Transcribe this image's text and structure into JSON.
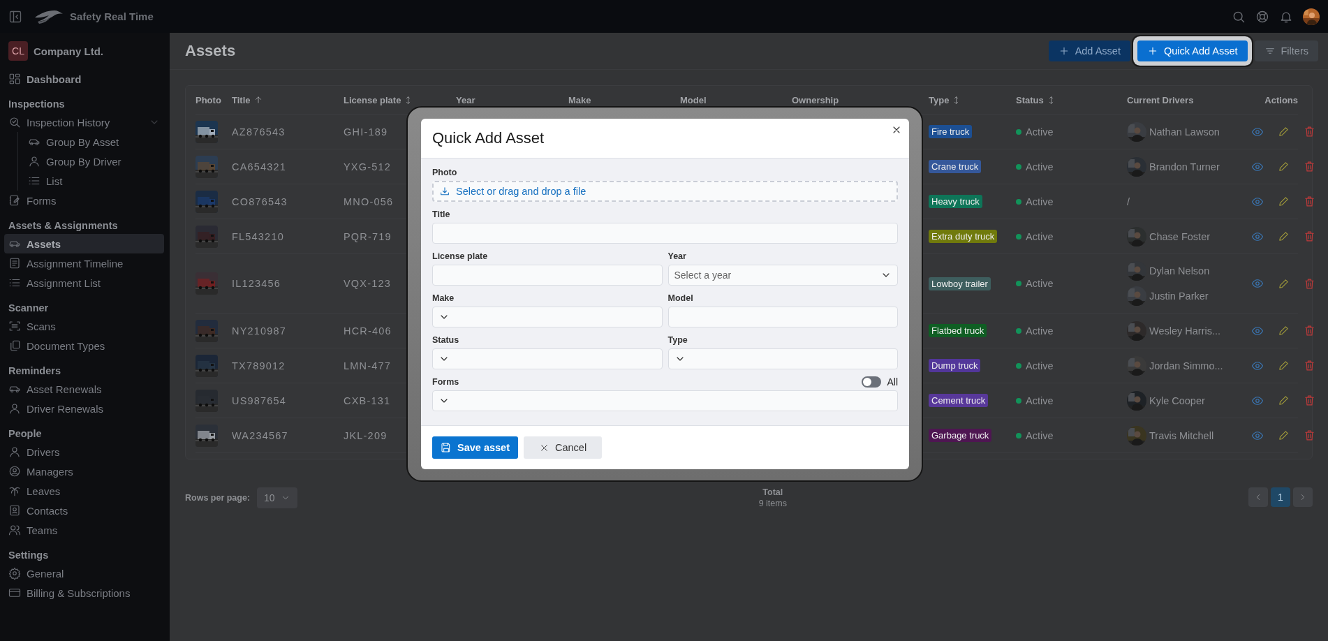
{
  "app": {
    "title": "Safety Real Time"
  },
  "sidebar": {
    "company": {
      "initials": "CL",
      "name": "Company Ltd."
    },
    "sections": [
      {
        "items": [
          {
            "label": "Dashboard",
            "kind": "dashboard",
            "selected": false
          }
        ]
      },
      {
        "heading": "Inspections",
        "items": [
          {
            "label": "Inspection History",
            "kind": "history",
            "selected": false,
            "expanded": true,
            "children": [
              {
                "label": "Group By Asset",
                "kind": "car",
                "selected": false
              },
              {
                "label": "Group By Driver",
                "kind": "person",
                "selected": false
              },
              {
                "label": "List",
                "kind": "list",
                "selected": false
              }
            ]
          },
          {
            "label": "Forms",
            "kind": "form",
            "selected": false
          }
        ]
      },
      {
        "heading": "Assets & Assignments",
        "items": [
          {
            "label": "Assets",
            "kind": "car",
            "selected": true
          },
          {
            "label": "Assignment Timeline",
            "kind": "document",
            "selected": false
          },
          {
            "label": "Assignment List",
            "kind": "list",
            "selected": false
          }
        ]
      },
      {
        "heading": "Scanner",
        "items": [
          {
            "label": "Scans",
            "kind": "scan",
            "selected": false
          },
          {
            "label": "Document Types",
            "kind": "copies",
            "selected": false
          }
        ]
      },
      {
        "heading": "Reminders",
        "items": [
          {
            "label": "Asset Renewals",
            "kind": "car",
            "selected": false
          },
          {
            "label": "Driver Renewals",
            "kind": "person",
            "selected": false
          }
        ]
      },
      {
        "heading": "People",
        "items": [
          {
            "label": "Drivers",
            "kind": "person",
            "selected": false
          },
          {
            "label": "Managers",
            "kind": "user-circle",
            "selected": false
          },
          {
            "label": "Leaves",
            "kind": "palm",
            "selected": false
          },
          {
            "label": "Contacts",
            "kind": "contact",
            "selected": false
          },
          {
            "label": "Teams",
            "kind": "people",
            "selected": false
          }
        ]
      },
      {
        "heading": "Settings",
        "items": [
          {
            "label": "General",
            "kind": "gear",
            "selected": false
          },
          {
            "label": "Billing & Subscriptions",
            "kind": "card",
            "selected": false
          }
        ]
      }
    ]
  },
  "page": {
    "title": "Assets",
    "actions": [
      {
        "label": "Add Asset",
        "kind": "add",
        "highlighted": false
      },
      {
        "label": "Quick Add Asset",
        "kind": "add",
        "highlighted": true
      },
      {
        "label": "Filters",
        "kind": "filter",
        "highlighted": false
      }
    ]
  },
  "table": {
    "columns": [
      {
        "label": "Photo",
        "sortable": false,
        "sorted_ascending": false
      },
      {
        "label": "Title",
        "sortable": true,
        "sorted_ascending": true
      },
      {
        "label": "License plate",
        "sortable": true,
        "sorted_ascending": false
      },
      {
        "label": "Year",
        "sortable": false,
        "sorted_ascending": false
      },
      {
        "label": "Make",
        "sortable": false,
        "sorted_ascending": false
      },
      {
        "label": "Model",
        "sortable": false,
        "sorted_ascending": false
      },
      {
        "label": "Ownership",
        "sortable": false,
        "sorted_ascending": false
      },
      {
        "label": "Type",
        "sortable": true,
        "sorted_ascending": false
      },
      {
        "label": "Status",
        "sortable": true,
        "sorted_ascending": false
      },
      {
        "label": "Current Drivers",
        "sortable": false,
        "sorted_ascending": false
      },
      {
        "label": "Actions",
        "sortable": false,
        "sorted_ascending": false
      }
    ],
    "rows": [
      {
        "title": "AZ876543",
        "license_plate": "GHI-189",
        "type": {
          "label": "Fire truck",
          "color": "#1c4f93"
        },
        "status": "Active",
        "current_drivers": [
          "Nathan Lawson"
        ]
      },
      {
        "title": "CA654321",
        "license_plate": "YXG-512",
        "type": {
          "label": "Crane truck",
          "color": "#35589a"
        },
        "status": "Active",
        "current_drivers": [
          "Brandon Turner"
        ]
      },
      {
        "title": "CO876543",
        "license_plate": "MNO-056",
        "type": {
          "label": "Heavy truck",
          "color": "#0e7558"
        },
        "status": "Active",
        "current_drivers": "/"
      },
      {
        "title": "FL543210",
        "license_plate": "PQR-719",
        "type": {
          "label": "Extra duty truck",
          "color": "#707a0c"
        },
        "status": "Active",
        "current_drivers": [
          "Chase Foster"
        ]
      },
      {
        "title": "IL123456",
        "license_plate": "VQX-123",
        "type": {
          "label": "Lowboy trailer",
          "color": "#3e5e5e"
        },
        "status": "Active",
        "current_drivers": [
          "Dylan Nelson",
          "Justin Parker"
        ]
      },
      {
        "title": "NY210987",
        "license_plate": "HCR-406",
        "type": {
          "label": "Flatbed truck",
          "color": "#0f5e23"
        },
        "status": "Active",
        "current_drivers": [
          "Wesley Harris..."
        ]
      },
      {
        "title": "TX789012",
        "license_plate": "LMN-477",
        "type": {
          "label": "Dump truck",
          "color": "#52369a"
        },
        "status": "Active",
        "current_drivers": [
          "Jordan Simmo..."
        ]
      },
      {
        "title": "US987654",
        "license_plate": "CXB-131",
        "type": {
          "label": "Cement truck",
          "color": "#58389a"
        },
        "status": "Active",
        "current_drivers": [
          "Kyle Cooper"
        ]
      },
      {
        "title": "WA234567",
        "license_plate": "JKL-209",
        "type": {
          "label": "Garbage truck",
          "color": "#4e1652"
        },
        "status": "Active",
        "current_drivers": [
          "Travis Mitchell"
        ]
      }
    ]
  },
  "pagination": {
    "rows_per_page": {
      "label": "Rows per page:",
      "value": "10"
    },
    "total": {
      "label": "Total",
      "value": "9 items"
    },
    "pages": [
      {
        "label": "1",
        "selected": true
      }
    ]
  },
  "quick_add_modal": {
    "title": "Quick Add Asset",
    "rows": [
      [
        {
          "label": "Photo",
          "kind": "upload",
          "prompt": "Select or drag and drop a file"
        }
      ],
      [
        {
          "label": "Title",
          "kind": "text"
        }
      ],
      [
        {
          "label": "License plate",
          "kind": "text"
        },
        {
          "label": "Year",
          "kind": "select",
          "placeholder": "Select a year"
        }
      ],
      [
        {
          "label": "Make",
          "kind": "select"
        },
        {
          "label": "Model",
          "kind": "text"
        }
      ],
      [
        {
          "label": "Status",
          "kind": "select"
        },
        {
          "label": "Type",
          "kind": "select"
        }
      ],
      [
        {
          "label": "Forms",
          "kind": "select",
          "toggle": {
            "label": "All",
            "on": false
          }
        }
      ]
    ],
    "buttons": [
      {
        "label": "Save asset",
        "kind": "primary"
      },
      {
        "label": "Cancel",
        "kind": "secondary"
      }
    ]
  }
}
